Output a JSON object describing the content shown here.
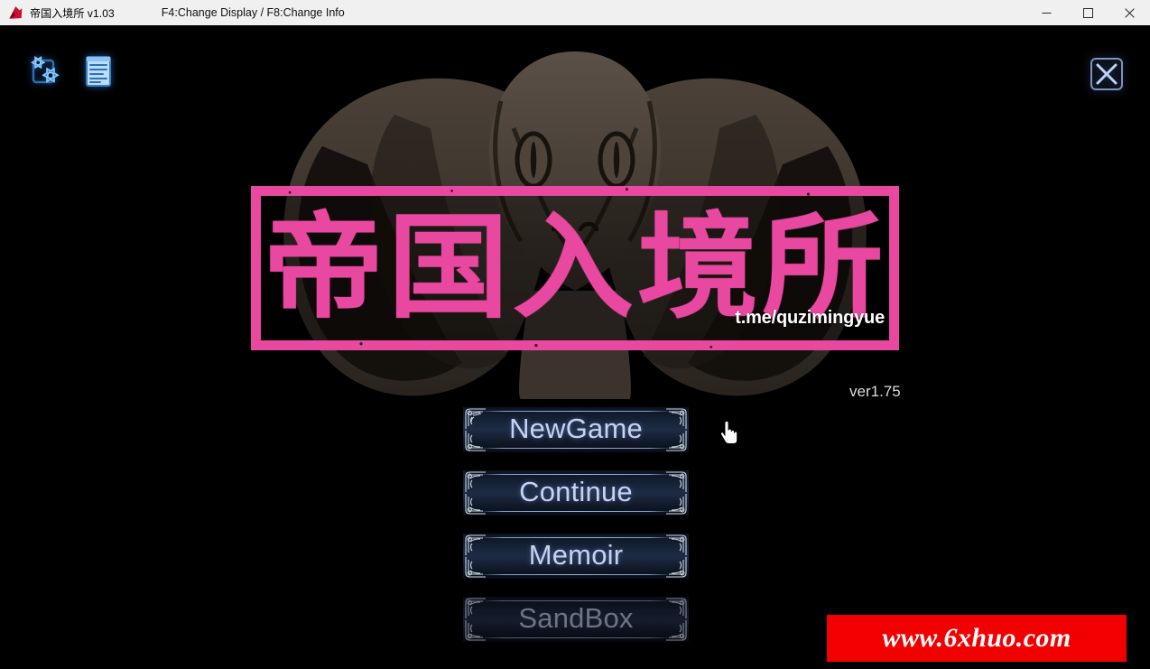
{
  "window": {
    "app_icon": "app-icon",
    "title": "帝国入境所 v1.03",
    "hint": "F4:Change Display / F8:Change Info",
    "controls": {
      "minimize": "minimize-icon",
      "maximize": "maximize-icon",
      "close": "close-icon"
    }
  },
  "game": {
    "background_color": "#000000",
    "tool_icons": [
      {
        "name": "settings-gears-icon",
        "color": "#4aa3ff"
      },
      {
        "name": "document-list-icon",
        "color": "#6fc2ff"
      }
    ],
    "close_button": {
      "name": "close-x-icon",
      "color": "#a8c8f0"
    },
    "logo": {
      "title_cjk": "帝国入境所",
      "watermark": "t.me/quzimingyue",
      "frame_color": "#e8489f",
      "text_color": "#e8489f"
    },
    "version": "ver1.75",
    "menu": [
      {
        "label": "NewGame",
        "enabled": true
      },
      {
        "label": "Continue",
        "enabled": true
      },
      {
        "label": "Memoir",
        "enabled": true
      },
      {
        "label": "SandBox",
        "enabled": false
      }
    ],
    "promo": {
      "text": "www.6xhuo.com",
      "background": "#f20000",
      "text_color": "#ffffff"
    },
    "cursor": "hand-pointer-cursor"
  }
}
